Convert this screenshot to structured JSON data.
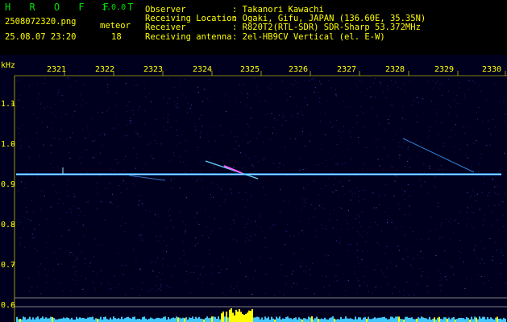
{
  "app": {
    "name": "H R O F F T",
    "version": "1.0.0"
  },
  "file": {
    "name": "2508072320.png",
    "datetime": "25.08.07 23:20"
  },
  "meteor": {
    "label": "meteor",
    "count": "18"
  },
  "info": [
    {
      "key": "Observer",
      "value": ": Takanori Kawachi"
    },
    {
      "key": "Receiving Location",
      "value": ": Ogaki, Gifu, JAPAN (136.60E, 35.35N)"
    },
    {
      "key": "Receiver",
      "value": ": R820T2(RTL-SDR) SDR-Sharp 53.372MHz"
    },
    {
      "key": "Receiving antenna",
      "value": ": 2el-HB9CV Vertical (el. E-W)"
    }
  ],
  "axis": {
    "unit": "kHz",
    "time_ticks": [
      "2321",
      "2322",
      "2323",
      "2324",
      "2325",
      "2326",
      "2327",
      "2328",
      "2329",
      "2330"
    ],
    "freq_ticks": [
      "1.1",
      "1.0",
      "0.9",
      "0.8",
      "0.7",
      "0.6"
    ]
  },
  "colors": {
    "background": "#00001e",
    "label_yellow": "#ffff00",
    "title_green": "#00e000",
    "carrier": "#5fd0ff",
    "bar_cyan": "#40c8ff",
    "bar_yellow": "#ffff00"
  }
}
